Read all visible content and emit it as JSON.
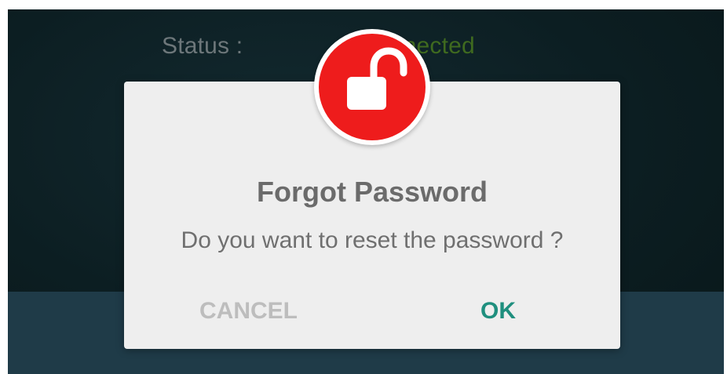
{
  "background": {
    "status_label": "Status :",
    "status_value": "Connected",
    "status_color": "#3f6a1f"
  },
  "dialog": {
    "icon": "unlocked-padlock-icon",
    "icon_color": "#ee1c1c",
    "title": "Forgot Password",
    "message": "Do you want to reset the password ?",
    "cancel_label": "CANCEL",
    "ok_label": "OK",
    "ok_color": "#1f8f7e"
  }
}
